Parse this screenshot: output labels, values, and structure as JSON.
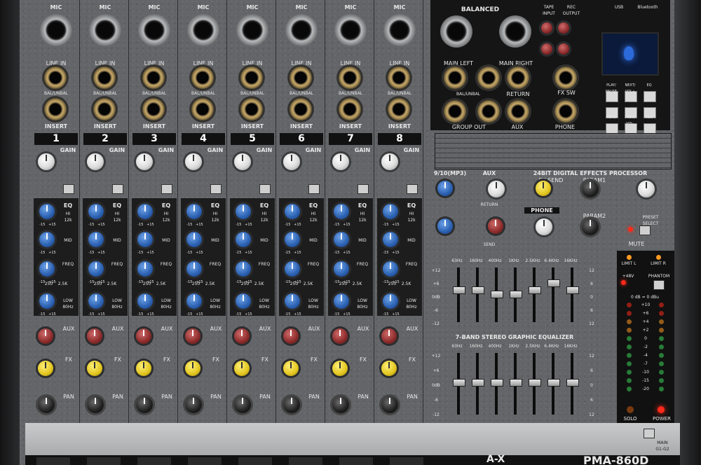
{
  "channels": {
    "numbers": [
      "1",
      "2",
      "3",
      "4",
      "5",
      "6",
      "7",
      "8"
    ],
    "mic_label": "MIC",
    "line_in_label": "LINE IN",
    "balunbal_label": "BAL/UNBAL",
    "insert_label": "INSERT",
    "gain_label": "GAIN",
    "eq_label": "EQ",
    "hi_label": "HI\n12k",
    "mid_label": "MID",
    "freq_label": "FREQ",
    "low_label": "LOW\n80Hz",
    "aux_label": "AUX",
    "fx_label": "FX",
    "pan_label": "PAN",
    "eq_range": "-15   +15",
    "freq_range": "250    2.5K"
  },
  "outputs": {
    "balanced": "BALANCED",
    "main_left": "MAIN LEFT",
    "main_right": "MAIN RIGHT",
    "balunbal": "BAL/UNBAL",
    "return": "RETURN",
    "group_out": "GROUP OUT",
    "aux": "AUX",
    "tape_input": "TAPE\nINPUT",
    "rec_output": "REC\nOUTPUT",
    "fx_sw": "FX SW",
    "phone": "PHONE",
    "bluetooth": "Bluetooth",
    "usb": "USB"
  },
  "player_buttons": [
    "PLAY/\nPAUSE",
    "NEXT/\nVOL+",
    "EQ",
    "",
    "",
    "",
    "MENU",
    "PREV/\nVOL-",
    "REC"
  ],
  "effects": {
    "title": "24BIT DIGITAL EFFECTS PROCESSOR",
    "fx_send": "FX SEND",
    "param1": "PARAM1",
    "param2": "PARAM2",
    "preset_select": "PRESET\nSELECT",
    "mute": "MUTE",
    "section_9_10": "9/10(MP3)",
    "aux": "AUX",
    "phone": "PHONE",
    "return": "RETURN",
    "send": "SEND"
  },
  "graphic_eq": {
    "title": "7-BAND STEREO GRAPHIC EQUALIZER",
    "bands": [
      "63Hz",
      "160Hz",
      "400Hz",
      "1KHz",
      "2.5KHz",
      "6.4KHz",
      "16KHz"
    ],
    "side_scale_left": [
      "+12",
      "+6",
      "0dB",
      "-6",
      "-12"
    ],
    "side_scale_right": [
      "12",
      "6",
      "0",
      "6",
      "12"
    ],
    "top_row_levels": [
      0.35,
      0.35,
      0.42,
      0.42,
      0.35,
      0.22,
      0.35
    ],
    "bottom_row_levels": [
      0.42,
      0.42,
      0.42,
      0.42,
      0.42,
      0.42,
      0.42
    ]
  },
  "master": {
    "limit_l": "LIMIT L",
    "limit_r": "LIMIT R",
    "phantom_48v": "+48V",
    "phantom": "PHANTOM",
    "zero_db": "0 dB = 0 dBu",
    "meter_marks": [
      "+10",
      "+6",
      "+4",
      "+2",
      "0",
      "-2",
      "-4",
      "-7",
      "-10",
      "-15",
      "-20"
    ],
    "solo": "SOLO",
    "power": "POWER",
    "main_switch": "MAIN\nG1-G2"
  },
  "brand": {
    "logo": "A-X",
    "model": "PMA-860D"
  },
  "colors": {
    "panel": "#636568",
    "blue_knob": "#2a5fb0",
    "red_knob": "#8c2a2a",
    "yellow_knob": "#e2c51e",
    "led_green": "#3bd35a",
    "led_red": "#ff2a1a",
    "led_orange": "#ff9a22"
  }
}
